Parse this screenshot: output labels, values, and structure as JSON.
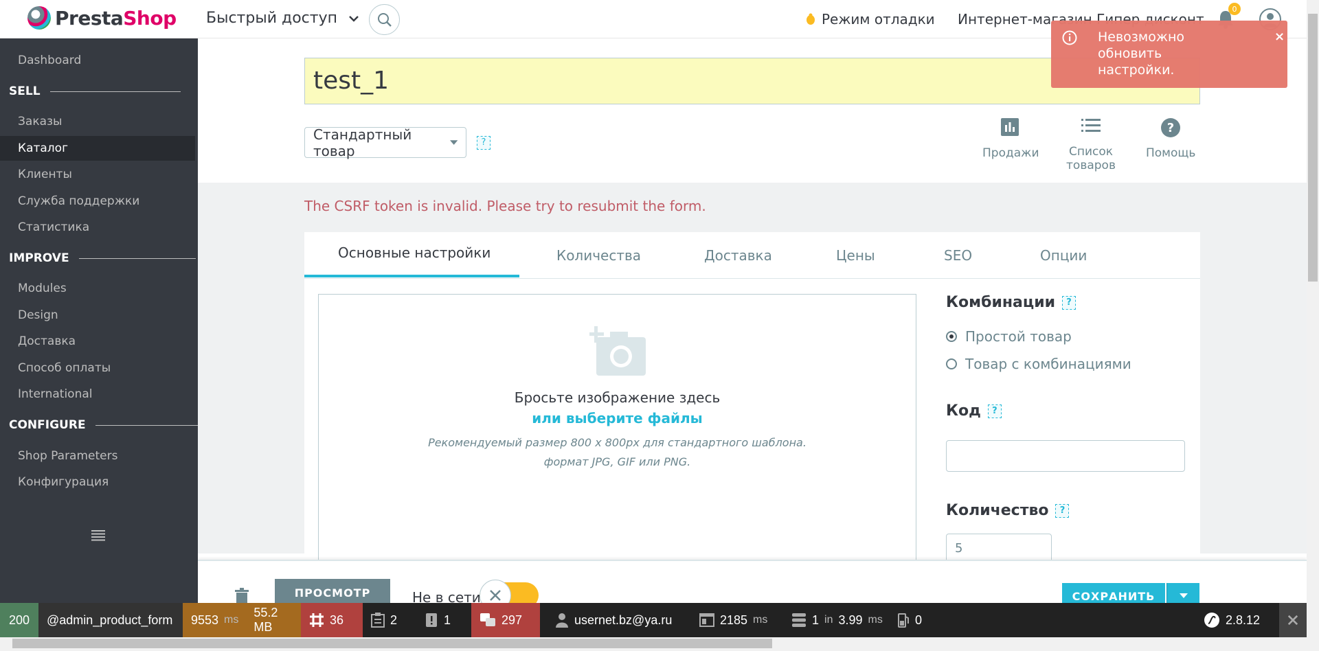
{
  "header": {
    "logo_presta": "Presta",
    "logo_shop": "Shop",
    "quick_access": "Быстрый доступ",
    "debug_mode": "Режим отладки",
    "shop_name": "Интернет-магазин Гипер дисконт",
    "notifications_count": "0"
  },
  "sidebar": {
    "items": [
      {
        "type": "link",
        "label": "Dashboard"
      },
      {
        "type": "section",
        "label": "SELL"
      },
      {
        "type": "link",
        "label": "Заказы"
      },
      {
        "type": "link",
        "label": "Каталог",
        "active": true
      },
      {
        "type": "link",
        "label": "Клиенты"
      },
      {
        "type": "link",
        "label": "Служба поддержки"
      },
      {
        "type": "link",
        "label": "Статистика"
      },
      {
        "type": "section",
        "label": "IMPROVE"
      },
      {
        "type": "link",
        "label": "Modules"
      },
      {
        "type": "link",
        "label": "Design"
      },
      {
        "type": "link",
        "label": "Доставка"
      },
      {
        "type": "link",
        "label": "Способ оплаты"
      },
      {
        "type": "link",
        "label": "International"
      },
      {
        "type": "section",
        "label": "CONFIGURE"
      },
      {
        "type": "link",
        "label": "Shop Parameters"
      },
      {
        "type": "link",
        "label": "Конфигурация"
      }
    ]
  },
  "product": {
    "name": "test_1",
    "type": "Стандартный товар",
    "help": "?"
  },
  "top_actions": {
    "sales": "Продажи",
    "product_list": "Список товаров",
    "help": "Помощь"
  },
  "error": {
    "csrf": "The CSRF token is invalid. Please try to resubmit the form."
  },
  "tabs": [
    "Основные настройки",
    "Количества",
    "Доставка",
    "Цены",
    "SEO",
    "Опции"
  ],
  "dropzone": {
    "line1": "Бросьте изображение здесь",
    "line2": "или выберите файлы",
    "line3": "Рекомендуемый размер 800 x 800px для стандартного шаблона.",
    "line4": "формат JPG, GIF или PNG."
  },
  "right": {
    "combinations_title": "Комбинации",
    "simple": "Простой товар",
    "with_combinations": "Товар с комбинациями",
    "code_title": "Код",
    "code_value": "",
    "quantity_title": "Количество",
    "quantity_value": "5"
  },
  "toast": {
    "message": "Невозможно обновить настройки.",
    "close": "×"
  },
  "footer": {
    "preview": "ПРОСМОТР",
    "offline": "Не в сети",
    "save": "СОХРАНИТЬ"
  },
  "symfony": {
    "status": "200",
    "route": "@admin_product_form",
    "time": "9553",
    "time_unit": "ms",
    "memory": "55.2 MB",
    "events": "36",
    "logs": "2",
    "warnings": "1",
    "translations": "297",
    "user": "usernet.bz@ya.ru",
    "render_time": "2185",
    "render_unit": "ms",
    "db_queries": "1",
    "db_in": "in",
    "db_time": "3.99",
    "db_unit": "ms",
    "cache": "0",
    "version": "2.8.12"
  },
  "colors": {
    "accent": "#25b9d7",
    "sidebar": "#363a41",
    "toast": "#e5786d",
    "error_text": "#c05c67"
  }
}
